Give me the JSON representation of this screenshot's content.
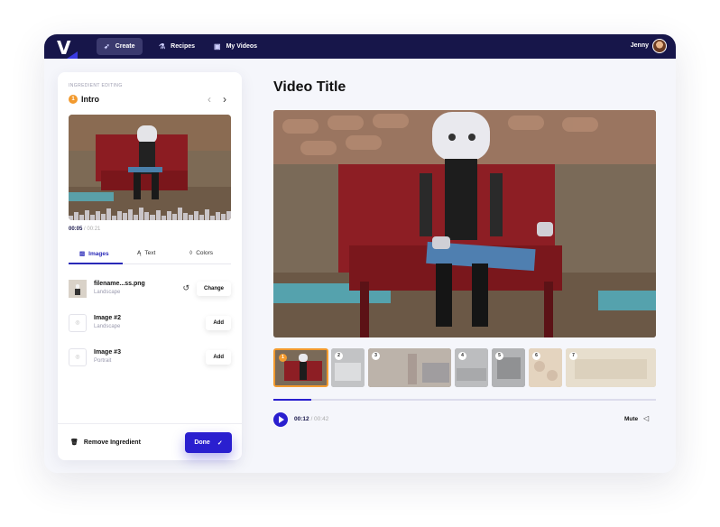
{
  "app": {
    "logo": "V"
  },
  "nav": {
    "items": [
      {
        "label": "Create",
        "icon": "rocket-icon"
      },
      {
        "label": "Recipes",
        "icon": "flask-icon"
      },
      {
        "label": "My Videos",
        "icon": "play-square-icon"
      }
    ],
    "user": "Jenny"
  },
  "panel": {
    "caption": "INGREDIENT EDITING",
    "ingredient_number": "1",
    "ingredient_title": "Intro",
    "time_current": "00:05",
    "time_total": "/ 00:21",
    "tabs": [
      {
        "label": "Images"
      },
      {
        "label": "Text"
      },
      {
        "label": "Colors"
      }
    ],
    "images": [
      {
        "name": "filename...ss.png",
        "orientation": "Landscape",
        "action": "Change"
      },
      {
        "name": "Image #2",
        "orientation": "Landscape",
        "action": "Add"
      },
      {
        "name": "Image #3",
        "orientation": "Portrait",
        "action": "Add"
      }
    ],
    "remove_label": "Remove Ingredient",
    "done_label": "Done"
  },
  "video": {
    "title": "Video Title",
    "frames": [
      "1",
      "2",
      "3",
      "4",
      "5",
      "6",
      "7"
    ],
    "progress": 0.1,
    "time_current": "00:12",
    "time_total": "/ 00:42",
    "mute_label": "Mute"
  },
  "colors": {
    "nav_bg": "#17164a",
    "accent": "#2a1fcf",
    "orange": "#f29a2e"
  }
}
